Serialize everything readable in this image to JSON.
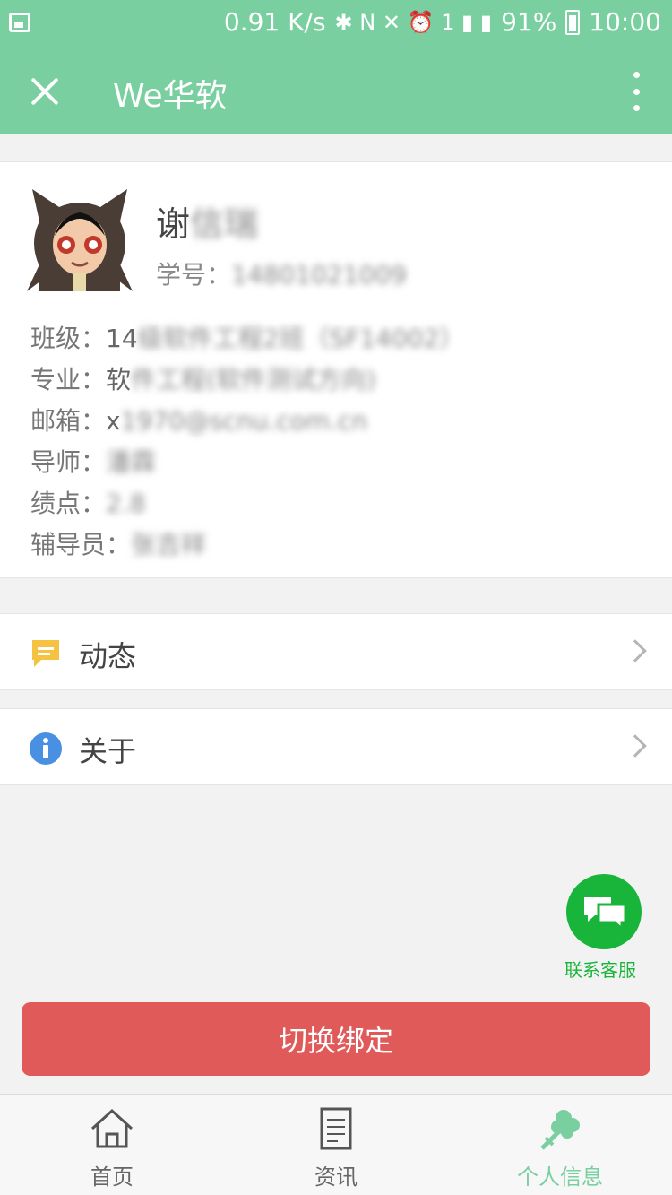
{
  "statusbar": {
    "net_speed": "0.91 K/s",
    "battery": "91%",
    "time": "10:00",
    "glyphs": "✱ N ✕ ⏰ 1 ▮ ▮"
  },
  "header": {
    "title": "We华软"
  },
  "profile": {
    "name_visible": "谢",
    "name_blurred": "信瑞",
    "student_id_label": "学号：",
    "student_id_value": "14801021009",
    "fields": [
      {
        "label": "班级：",
        "value_visible": "14",
        "value_blurred": "级软件工程2班（SF14002）"
      },
      {
        "label": "专业：",
        "value_visible": "软",
        "value_blurred": "件工程(软件测试方向)"
      },
      {
        "label": "邮箱：",
        "value_visible": "x",
        "value_blurred": "1970@scnu.com.cn"
      },
      {
        "label": "导师：",
        "value_visible": "",
        "value_blurred": "潘霖"
      },
      {
        "label": "绩点：",
        "value_visible": "",
        "value_blurred": "2.8"
      },
      {
        "label": "辅导员：",
        "value_visible": "",
        "value_blurred": "张吉祥"
      }
    ]
  },
  "menu": {
    "dynamics_label": "动态",
    "about_label": "关于"
  },
  "customer_service": {
    "label": "联系客服"
  },
  "actions": {
    "switch_binding_label": "切换绑定"
  },
  "tabs": [
    {
      "label": "首页",
      "active": false
    },
    {
      "label": "资讯",
      "active": false
    },
    {
      "label": "个人信息",
      "active": true
    }
  ],
  "colors": {
    "header_green": "#7acfa0",
    "button_red": "#e05a5a",
    "service_green": "#19b43a",
    "dynamics_yellow": "#f5c242",
    "about_blue": "#4a90e2"
  }
}
